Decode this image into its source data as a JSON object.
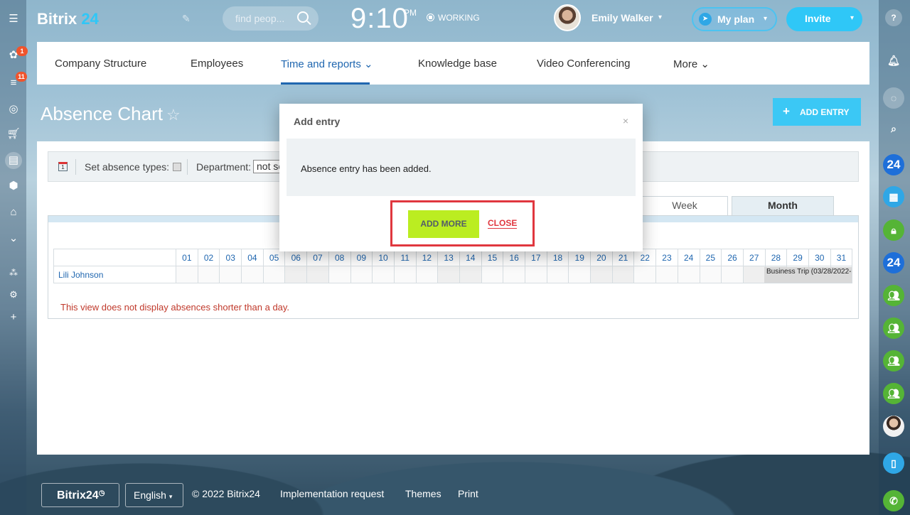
{
  "header": {
    "logo_text": "Bitrix",
    "logo_num": "24",
    "search_placeholder": "find peop...",
    "clock": "9:10",
    "clock_period": "PM",
    "status": "WORKING",
    "user_name": "Emily Walker",
    "myplan_label": "My plan",
    "invite_label": "Invite"
  },
  "left_rail": {
    "badges": [
      "1",
      "11"
    ]
  },
  "right_rail": {
    "items": [
      "?",
      "24",
      "24"
    ]
  },
  "nav": {
    "items": [
      "Company Structure",
      "Employees",
      "Time and reports",
      "Knowledge base",
      "Video Conferencing",
      "More"
    ]
  },
  "page": {
    "title": "Absence Chart",
    "add_entry_label": "ADD ENTRY"
  },
  "filters": {
    "calendar_day": "1",
    "absence_types_label": "Set absence types:",
    "department_label": "Department:",
    "department_value": "not se"
  },
  "tabs": {
    "week": "Week",
    "month": "Month"
  },
  "chart": {
    "days": [
      "01",
      "02",
      "03",
      "04",
      "05",
      "06",
      "07",
      "08",
      "09",
      "10",
      "11",
      "12",
      "13",
      "14",
      "15",
      "16",
      "17",
      "18",
      "19",
      "20",
      "21",
      "22",
      "23",
      "24",
      "25",
      "26",
      "27",
      "28",
      "29",
      "30",
      "31"
    ],
    "employee": "Lili Johnson",
    "trip_label": "Business Trip (03/28/2022-",
    "notice": "This view does not display absences shorter than a day."
  },
  "modal": {
    "title": "Add entry",
    "close_icon": "×",
    "message": "Absence entry has been added.",
    "add_more_label": "ADD MORE",
    "close_label": "CLOSE"
  },
  "footer": {
    "logo": "Bitrix24",
    "language": "English",
    "copyright": "© 2022 Bitrix24",
    "implementation": "Implementation request",
    "themes": "Themes",
    "print": "Print"
  }
}
